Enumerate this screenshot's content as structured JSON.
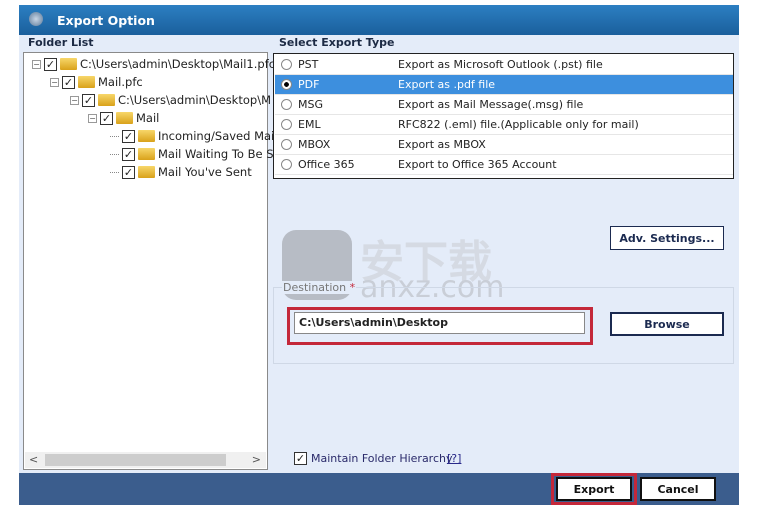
{
  "window": {
    "title": "Export Option"
  },
  "folder_list": {
    "label": "Folder List",
    "tree": [
      {
        "label": "C:\\Users\\admin\\Desktop\\Mail1.pfc",
        "checked": true
      },
      {
        "label": "Mail.pfc",
        "checked": true
      },
      {
        "label": "C:\\Users\\admin\\Desktop\\M",
        "checked": true
      },
      {
        "label": "Mail",
        "checked": true
      },
      {
        "label": "Incoming/Saved Mai",
        "checked": true
      },
      {
        "label": "Mail Waiting To Be S",
        "checked": true
      },
      {
        "label": "Mail You've Sent",
        "checked": true
      }
    ],
    "scroll_left": "<",
    "scroll_right": ">"
  },
  "export_type": {
    "label": "Select Export Type",
    "selected": "PDF",
    "options": [
      {
        "name": "PST",
        "desc": "Export as Microsoft Outlook (.pst) file"
      },
      {
        "name": "PDF",
        "desc": "Export as .pdf file"
      },
      {
        "name": "MSG",
        "desc": "Export as Mail Message(.msg) file"
      },
      {
        "name": "EML",
        "desc": "RFC822 (.eml) file.(Applicable only for mail)"
      },
      {
        "name": "MBOX",
        "desc": "Export as MBOX"
      },
      {
        "name": "Office 365",
        "desc": "Export to Office 365 Account"
      }
    ]
  },
  "adv_settings_label": "Adv. Settings...",
  "destination": {
    "label": "Destination",
    "required_mark": "*",
    "value": "C:\\Users\\admin\\Desktop",
    "browse_label": "Browse"
  },
  "maintain_hierarchy": {
    "label": "Maintain Folder Hierarchy",
    "help": "[?]",
    "checked": true
  },
  "footer": {
    "export_label": "Export",
    "cancel_label": "Cancel"
  },
  "watermark": {
    "text_cn": "安下载",
    "text_en": "anxz.com"
  },
  "colors": {
    "title_bar": "#1f68a8",
    "footer": "#3b5d8d",
    "selection": "#3d8fde",
    "highlight": "#c4283a"
  }
}
